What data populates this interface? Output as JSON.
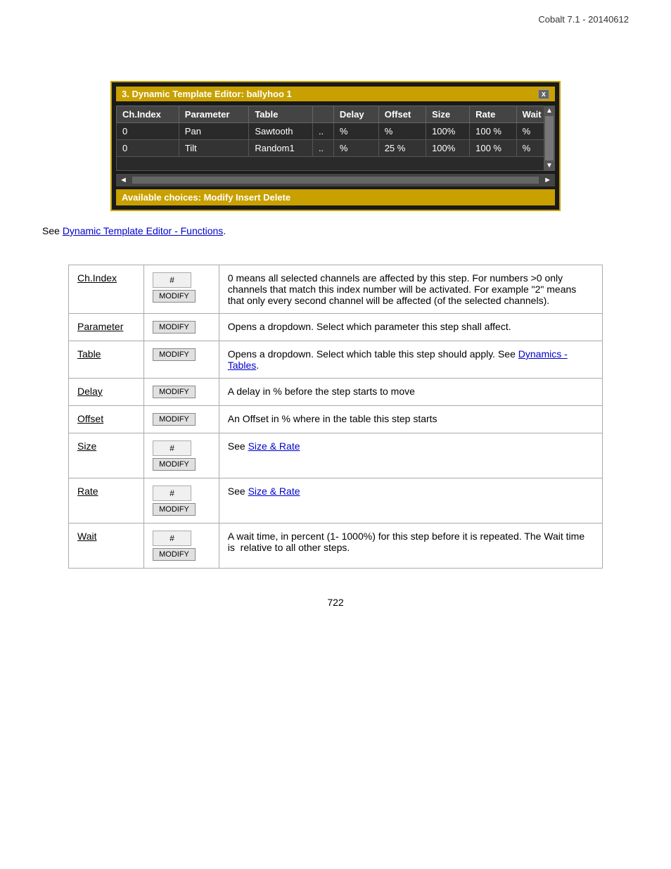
{
  "header": {
    "title": "Cobalt 7.1 - 20140612"
  },
  "editor": {
    "titlebar": "3. Dynamic Template Editor: ballyhoo 1",
    "close_btn": "x",
    "columns": [
      "Ch.Index",
      "Parameter",
      "Table",
      "",
      "Delay",
      "Offset",
      "Size",
      "Rate",
      "Wait"
    ],
    "rows": [
      [
        "0",
        "Pan",
        "Sawtooth",
        "..",
        "%",
        "%",
        "100%",
        "100 %",
        "%"
      ],
      [
        "0",
        "Tilt",
        "Random1",
        "..",
        "%",
        "25 %",
        "100%",
        "100 %",
        "%"
      ]
    ],
    "bottom_bar": "Available choices: Modify Insert Delete"
  },
  "see_link": {
    "prefix": "See ",
    "link_text": "Dynamic Template Editor - Functions",
    "suffix": "."
  },
  "ref_table": {
    "rows": [
      {
        "label": "Ch.Index",
        "has_hash": true,
        "has_modify": true,
        "description": "0 means all selected channels are affected by this step. For numbers >0 only channels that match this index number will be activated. For example \"2\" means that only every second channel will be affected (of the selected channels)."
      },
      {
        "label": "Parameter",
        "has_hash": false,
        "has_modify": true,
        "description": "Opens a dropdown. Select which parameter this step shall affect."
      },
      {
        "label": "Table",
        "has_hash": false,
        "has_modify": true,
        "description": "Opens a dropdown. Select which table this step should apply. See Dynamics - Tables.",
        "desc_link": "Dynamics - Tables"
      },
      {
        "label": "Delay",
        "has_hash": false,
        "has_modify": true,
        "description": "A delay in % before the step starts to move"
      },
      {
        "label": "Offset",
        "has_hash": false,
        "has_modify": true,
        "description": "An Offset in % where in the table this step starts"
      },
      {
        "label": "Size",
        "has_hash": true,
        "has_modify": true,
        "description": "See Size & Rate",
        "desc_link": "Size & Rate"
      },
      {
        "label": "Rate",
        "has_hash": true,
        "has_modify": true,
        "description": "See Size & Rate",
        "desc_link": "Size & Rate"
      },
      {
        "label": "Wait",
        "has_hash": true,
        "has_modify": true,
        "description": "A wait time, in percent (1- 1000%) for this step before it is repeated. The Wait time is  relative to all other steps."
      }
    ],
    "hash_placeholder": "#",
    "modify_label": "MODIFY"
  },
  "page_number": "722"
}
